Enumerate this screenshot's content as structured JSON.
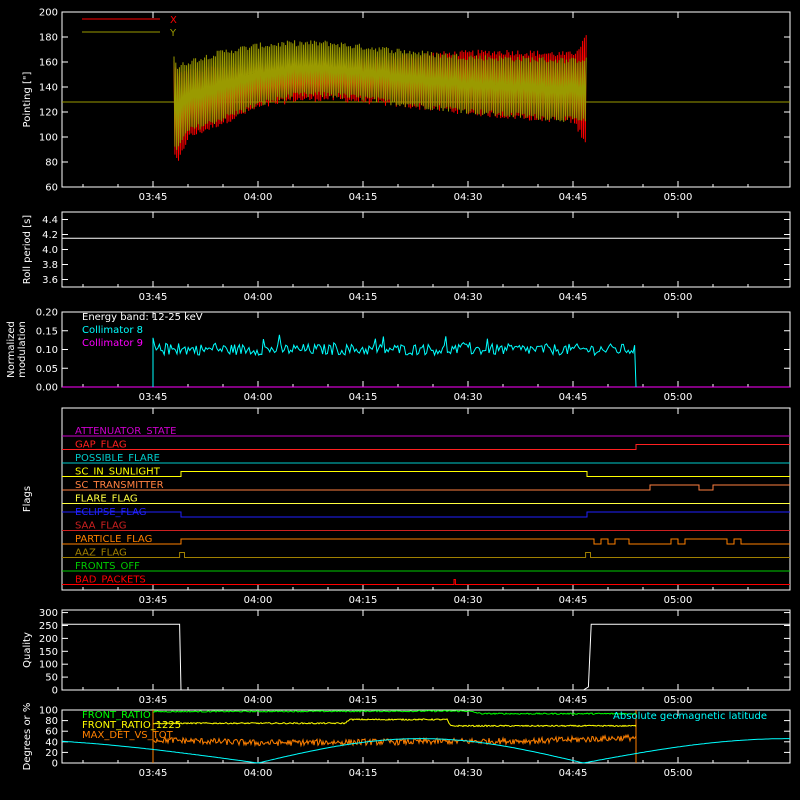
{
  "x_ticks": [
    "03:45",
    "04:00",
    "04:15",
    "04:30",
    "04:45",
    "05:00"
  ],
  "x_tick_minutes": [
    225,
    240,
    255,
    270,
    285,
    300
  ],
  "x_range_minutes": [
    212,
    316
  ],
  "chart_data": [
    {
      "type": "line",
      "ylabel": "Pointing [\"]",
      "ylim": [
        60,
        200
      ],
      "yticks": [
        60,
        80,
        100,
        120,
        140,
        160,
        180,
        200
      ],
      "legend": "top-left",
      "baseline": 128,
      "series": [
        {
          "name": "X",
          "color": "#ff0000",
          "x": [
            228,
            228.5,
            230,
            235,
            240,
            245,
            250,
            255,
            260,
            265,
            270,
            275,
            280,
            285,
            287
          ],
          "upper": [
            160,
            150,
            152,
            156,
            158,
            159,
            160,
            162,
            164,
            166,
            167,
            168,
            167,
            166,
            180
          ],
          "lower": [
            90,
            78,
            100,
            112,
            124,
            130,
            131,
            129,
            126,
            123,
            120,
            117,
            115,
            113,
            95
          ]
        },
        {
          "name": "Y",
          "color": "#9a9a00",
          "x": [
            228,
            228.5,
            230,
            235,
            240,
            245,
            250,
            255,
            260,
            265,
            270,
            275,
            280,
            285,
            287
          ],
          "upper": [
            165,
            155,
            160,
            168,
            173,
            175,
            175,
            172,
            169,
            166,
            164,
            163,
            162,
            161,
            163
          ],
          "lower": [
            95,
            90,
            105,
            115,
            126,
            133,
            134,
            131,
            127,
            124,
            121,
            118,
            116,
            114,
            112
          ]
        }
      ]
    },
    {
      "type": "line",
      "ylabel": "Roll period [s]",
      "ylim": [
        3.5,
        4.5
      ],
      "yticks": [
        3.6,
        3.8,
        4.0,
        4.2,
        4.4
      ],
      "series": [
        {
          "name": "",
          "color": "#ffffff",
          "x": [
            212,
            316
          ],
          "y": [
            4.15,
            4.15
          ]
        }
      ]
    },
    {
      "type": "line",
      "ylabel": "Normalized modulation",
      "ylim": [
        0,
        0.2
      ],
      "yticks": [
        0.0,
        0.05,
        0.1,
        0.15,
        0.2
      ],
      "legend": "top-left",
      "annotation": "Energy band: 12-25 keV",
      "series": [
        {
          "name": "Collimator 8",
          "color": "#00ffff",
          "x_start": 225,
          "x_end": 294,
          "level": 0.1
        },
        {
          "name": "Collimator 9",
          "color": "#ff00ff",
          "x": [
            212,
            316
          ],
          "y": [
            0,
            0
          ]
        }
      ]
    },
    {
      "type": "line",
      "ylabel": "Flags",
      "flags": [
        {
          "name": "ATTENUATOR_STATE",
          "color": "#cc00cc",
          "steps": [
            [
              212,
              0
            ]
          ]
        },
        {
          "name": "GAP_FLAG",
          "color": "#ff2020",
          "steps": [
            [
              212,
              0
            ],
            [
              294,
              1
            ]
          ]
        },
        {
          "name": "POSSIBLE_FLARE",
          "color": "#00cccc",
          "steps": [
            [
              212,
              0
            ]
          ]
        },
        {
          "name": "SC_IN_SUNLIGHT",
          "color": "#ffff00",
          "steps": [
            [
              212,
              0
            ],
            [
              229,
              1
            ],
            [
              287,
              0
            ]
          ]
        },
        {
          "name": "SC_TRANSMITTER",
          "color": "#ff8040",
          "steps": [
            [
              212,
              0
            ],
            [
              296,
              1
            ],
            [
              303,
              0
            ],
            [
              305,
              1
            ]
          ]
        },
        {
          "name": "FLARE_FLAG",
          "color": "#ffff40",
          "steps": [
            [
              212,
              0
            ]
          ]
        },
        {
          "name": "ECLIPSE_FLAG",
          "color": "#2020ff",
          "steps": [
            [
              212,
              1
            ],
            [
              229,
              0
            ],
            [
              287,
              1
            ]
          ]
        },
        {
          "name": "SAA_FLAG",
          "color": "#cc2020",
          "steps": [
            [
              212,
              0
            ]
          ]
        },
        {
          "name": "PARTICLE_FLAG",
          "color": "#ff8000",
          "steps": [
            [
              212,
              0
            ],
            [
              229,
              1
            ],
            [
              288,
              0
            ],
            [
              289,
              1
            ],
            [
              290,
              0
            ],
            [
              291,
              1
            ],
            [
              293,
              0
            ],
            [
              299,
              1
            ],
            [
              300,
              0
            ],
            [
              301,
              1
            ],
            [
              307,
              0
            ],
            [
              308,
              1
            ],
            [
              309,
              0
            ]
          ]
        },
        {
          "name": "AAZ_FLAG",
          "color": "#a08000",
          "steps": [
            [
              212,
              0
            ],
            [
              228.8,
              1
            ],
            [
              229.5,
              0
            ],
            [
              286.8,
              1
            ],
            [
              287.5,
              0
            ]
          ]
        },
        {
          "name": "FRONTS_OFF",
          "color": "#00cc00",
          "steps": [
            [
              212,
              0
            ]
          ]
        },
        {
          "name": "BAD_PACKETS",
          "color": "#ff0000",
          "steps": [
            [
              212,
              0
            ],
            [
              268,
              1
            ],
            [
              268.2,
              0
            ]
          ]
        }
      ]
    },
    {
      "type": "line",
      "ylabel": "Quality",
      "ylim": [
        0,
        310
      ],
      "yticks": [
        0,
        50,
        100,
        150,
        200,
        250,
        300
      ],
      "series": [
        {
          "name": "",
          "color": "#ffffff",
          "x": [
            212,
            228.8,
            229,
            286.5,
            287.2,
            287.6,
            316
          ],
          "y": [
            255,
            255,
            0,
            0,
            12,
            255,
            255
          ]
        }
      ]
    },
    {
      "type": "line",
      "ylabel": "Degrees or %",
      "ylim": [
        0,
        100
      ],
      "yticks": [
        0,
        20,
        40,
        60,
        80,
        100
      ],
      "legend": "top-left",
      "series": [
        {
          "name": "FRONT_RATIO",
          "color": "#00ff00",
          "x": [
            225,
            270,
            272,
            294
          ],
          "y": [
            97,
            98,
            93,
            93
          ]
        },
        {
          "name": "FRONT_RATIO_1225",
          "color": "#ffff00",
          "x": [
            225,
            252.5,
            253,
            267,
            267.5,
            294
          ],
          "y": [
            75,
            75,
            82,
            82,
            70,
            70
          ]
        },
        {
          "name": "MAX_DET_VS_TOT",
          "color": "#ff8000",
          "x": [
            225,
            240,
            260,
            280,
            294
          ],
          "y": [
            44,
            38,
            40,
            42,
            48
          ]
        },
        {
          "name": "Absolute geomagnetic latitude",
          "color": "#00ffff",
          "x": [
            212,
            221,
            240,
            258,
            286.5,
            300,
            316
          ],
          "y": [
            45,
            38,
            0,
            45,
            0,
            40,
            46
          ]
        }
      ]
    }
  ]
}
